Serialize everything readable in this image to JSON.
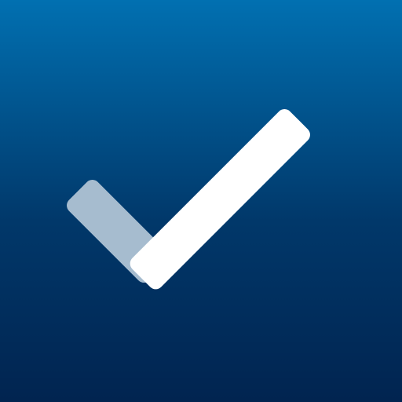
{
  "app_icon": {
    "icon_name": "checkmark-icon",
    "colors": {
      "background_top": "#0170B1",
      "background_mid": "#01386A",
      "background_bottom": "#012450",
      "check_short_stroke": "#A6BCCF",
      "check_long_stroke": "#FFFFFF"
    }
  }
}
